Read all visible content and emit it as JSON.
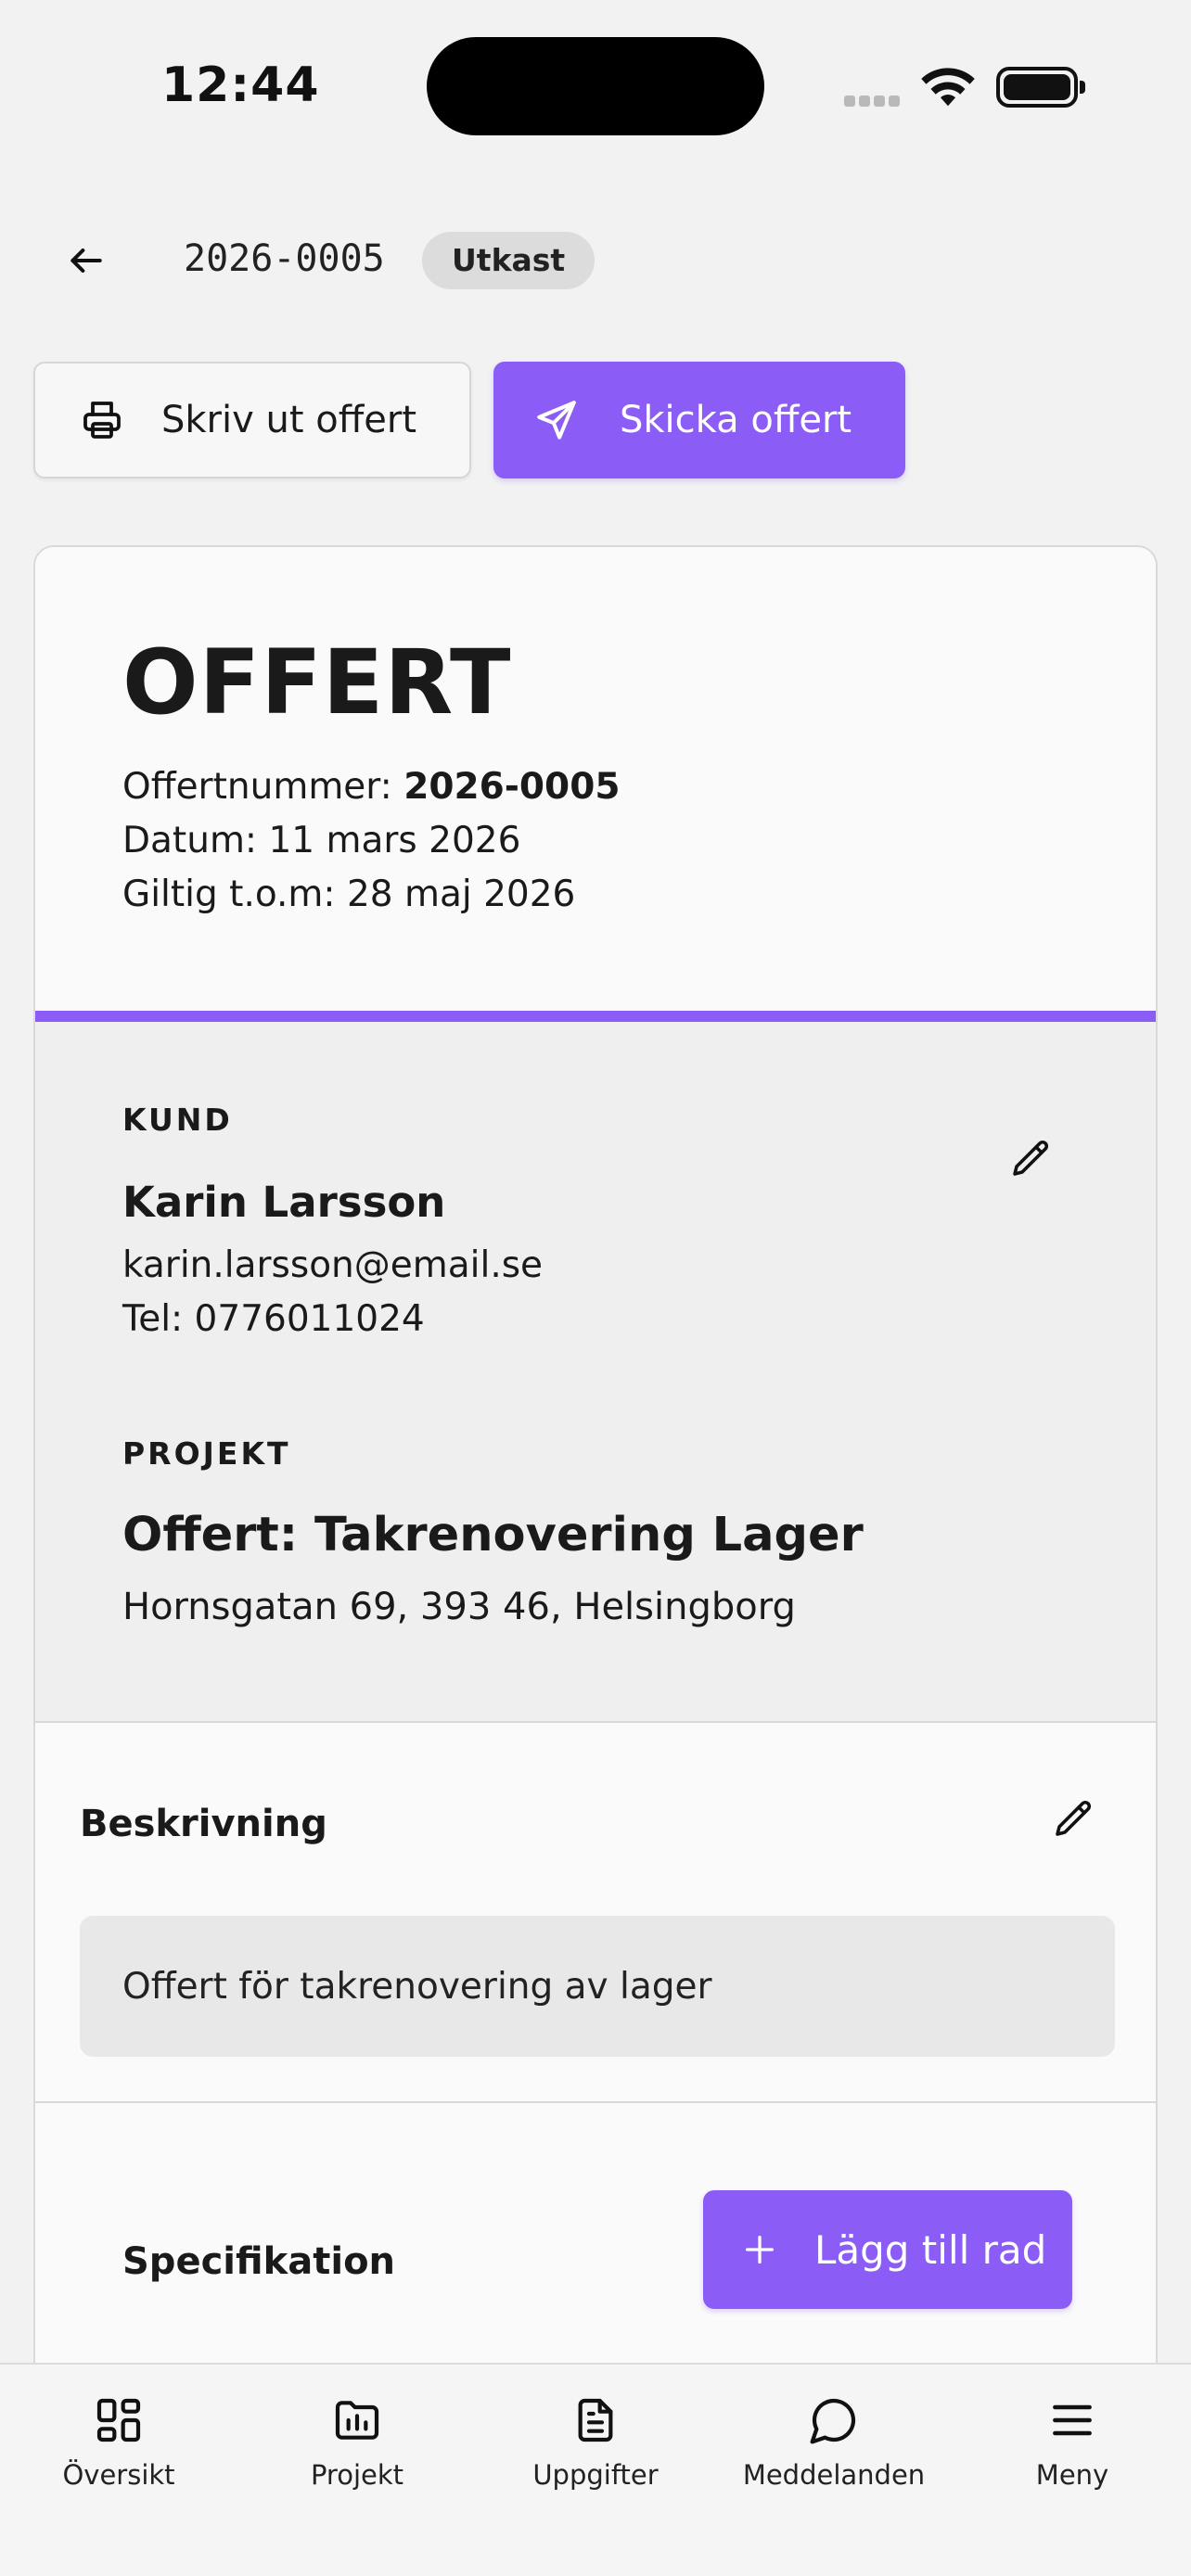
{
  "status_bar": {
    "time": "12:44"
  },
  "header": {
    "doc_number": "2026-0005",
    "status_badge": "Utkast"
  },
  "actions": {
    "print_label": "Skriv ut offert",
    "send_label": "Skicka offert"
  },
  "offer": {
    "title": "OFFERT",
    "number_label": "Offertnummer: ",
    "number_value": "2026-0005",
    "date_line": "Datum: 11 mars 2026",
    "valid_line": "Giltig t.o.m: 28 maj 2026"
  },
  "customer": {
    "section_label": "KUND",
    "name": "Karin Larsson",
    "email": "karin.larsson@email.se",
    "phone": "Tel: 0776011024"
  },
  "project": {
    "section_label": "PROJEKT",
    "title": "Offert: Takrenovering Lager",
    "address": "Hornsgatan 69, 393 46, Helsingborg"
  },
  "description": {
    "title": "Beskrivning",
    "text": "Offert för takrenovering av lager"
  },
  "specification": {
    "title": "Specifikation",
    "add_row_label": "Lägg till rad"
  },
  "nav": {
    "items": [
      {
        "label": "Översikt",
        "icon": "grid-icon"
      },
      {
        "label": "Projekt",
        "icon": "folder-chart-icon"
      },
      {
        "label": "Uppgifter",
        "icon": "document-icon"
      },
      {
        "label": "Meddelanden",
        "icon": "chat-bubble-icon"
      },
      {
        "label": "Meny",
        "icon": "hamburger-icon"
      }
    ]
  },
  "colors": {
    "accent": "#8b5cf6",
    "background": "#f2f2f2",
    "card": "#fafafa",
    "section_gray": "#efefef"
  }
}
